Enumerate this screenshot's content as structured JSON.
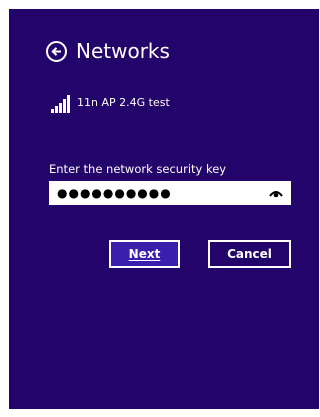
{
  "header": {
    "title": "Networks"
  },
  "network": {
    "name": "11n AP 2.4G test",
    "signal_icon": "signal-bars-icon"
  },
  "security_key": {
    "label": "Enter the network security key",
    "masked_value": "●●●●●●●●●●",
    "reveal_icon": "eye-icon"
  },
  "buttons": {
    "next_label": "Next",
    "cancel_label": "Cancel"
  },
  "colors": {
    "background": "#23046a",
    "accent_button": "#3a1fad",
    "text": "#ffffff"
  }
}
